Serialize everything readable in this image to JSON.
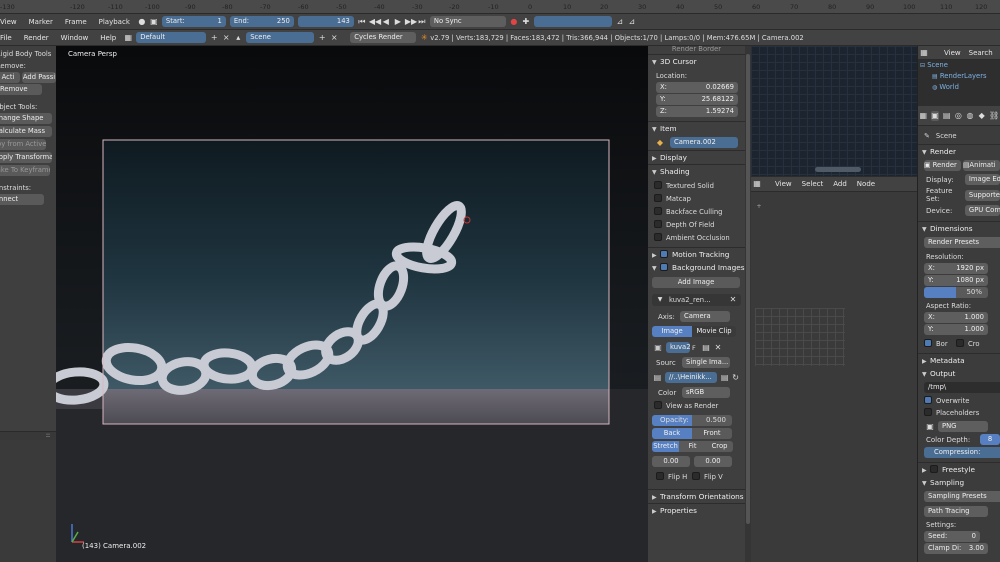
{
  "top_ruler": {
    "ticks": [
      "-130",
      "-120",
      "-110",
      "-100",
      "-90",
      "-80",
      "-70",
      "-60",
      "-50",
      "-40",
      "-30",
      "-20",
      "-10",
      "0",
      "10",
      "20",
      "30",
      "40",
      "50",
      "60",
      "70",
      "80",
      "90",
      "100",
      "110",
      "120",
      "130",
      "140",
      "150"
    ]
  },
  "timeline": {
    "menus": [
      "View",
      "Marker",
      "Frame",
      "Playback"
    ],
    "start_label": "Start:",
    "start_value": "1",
    "end_label": "End:",
    "end_value": "250",
    "current_frame": "143",
    "sync_mode": "No Sync"
  },
  "info_bar": {
    "menus": [
      "File",
      "Render",
      "Window",
      "Help"
    ],
    "layout": "Default",
    "scene": "Scene",
    "engine": "Cycles Render",
    "stats": "v2.79 | Verts:183,729 | Faces:183,472 | Tris:366,944 | Objects:1/70 | Lamps:0/0 | Mem:476.65M | Camera.002"
  },
  "tool_shelf": {
    "title": "Rigid Body Tools",
    "remove_label": "Remove:",
    "add_active": "Acti",
    "add_passive": "Add Passi",
    "remove_button": "Remove",
    "object_tools_label": "Object Tools:",
    "change_shape": "Change Shape",
    "calculate_mass": "Calculate Mass",
    "copy_from_active": "Copy from Active",
    "apply_transformation": "Apply Transformati...",
    "bake_to_keyframes": "Bake To Keyframes",
    "constraints_label": "Constraints:",
    "connect": "Connect"
  },
  "viewport": {
    "label": "Camera Persp",
    "object_label": "(143) Camera.002"
  },
  "n_panel": {
    "top_label": "Render Border",
    "cursor": {
      "header": "3D Cursor",
      "location_label": "Location:",
      "x_label": "X:",
      "x": "0.02669",
      "y_label": "Y:",
      "y": "25.68122",
      "z_label": "Z:",
      "z": "1.59274"
    },
    "item": {
      "header": "Item",
      "name": "Camera.002"
    },
    "display_header": "Display",
    "shading": {
      "header": "Shading",
      "options": [
        "Textured Solid",
        "Matcap",
        "Backface Culling",
        "Depth Of Field",
        "Ambient Occlusion"
      ]
    },
    "motion_tracking": "Motion Tracking",
    "background_images": {
      "header": "Background Images",
      "add_image": "Add Image",
      "image_name": "kuva2_ren...",
      "axis_label": "Axis:",
      "axis_value": "Camera",
      "tab_image": "Image",
      "tab_movie_clip": "Movie Clip",
      "image_field": "kuva2",
      "image_users": "F",
      "source_label": "Sourc",
      "source_value": "Single Ima...",
      "path": "//..\\Heinikk...",
      "color_label": "Color",
      "color_value": "sRGB",
      "view_as_render": "View as Render",
      "opacity_label": "Opacity:",
      "opacity_value": "0.500",
      "opacity_fraction": 0.5,
      "back": "Back",
      "front": "Front",
      "stretch": "Stretch",
      "fit": "Fit",
      "crop": "Crop",
      "offset_x": "0.00",
      "offset_y": "0.00",
      "flip_h": "Flip H",
      "flip_v": "Flip V"
    },
    "transform_orientations": "Transform Orientations",
    "properties": "Properties"
  },
  "node_editor": {
    "menus": [
      "View",
      "Select",
      "Add",
      "Node"
    ]
  },
  "outliner": {
    "view": "View",
    "search": "Search",
    "items": [
      "Scene",
      "RenderLayers",
      "World"
    ]
  },
  "properties": {
    "breadcrumb": "Scene",
    "render_header": "Render",
    "render_button": "Render",
    "animation_button": "Animati",
    "display_label": "Display:",
    "display_value": "Image Ed",
    "feature_set_label": "Feature Set:",
    "feature_set_value": "Supporte",
    "device_label": "Device:",
    "device_value": "GPU Com",
    "dimensions_header": "Dimensions",
    "render_presets": "Render Presets",
    "resolution_label": "Resolution:",
    "res_x_label": "X:",
    "res_x": "1920 px",
    "res_y_label": "Y:",
    "res_y": "1080 px",
    "res_percent": "50%",
    "res_percent_fraction": 0.5,
    "aspect_label": "Aspect Ratio:",
    "asp_x_label": "X:",
    "asp_x": "1.000",
    "asp_y_label": "Y:",
    "asp_y": "1.000",
    "border": "Bor",
    "crop": "Cro",
    "metadata_header": "Metadata",
    "output_header": "Output",
    "output_path": "/tmp\\",
    "overwrite": "Overwrite",
    "placeholders": "Placeholders",
    "format": "PNG",
    "color_depth_label": "Color Depth:",
    "color_depth_value": "8",
    "compression_label": "Compression:",
    "freestyle_header": "Freestyle",
    "sampling_header": "Sampling",
    "sampling_presets": "Sampling Presets",
    "integrator": "Path Tracing",
    "settings_label": "Settings:",
    "seed_label": "Seed:",
    "seed_value": "0",
    "clamp_label": "Clamp Di:",
    "clamp_value": "3.00"
  }
}
